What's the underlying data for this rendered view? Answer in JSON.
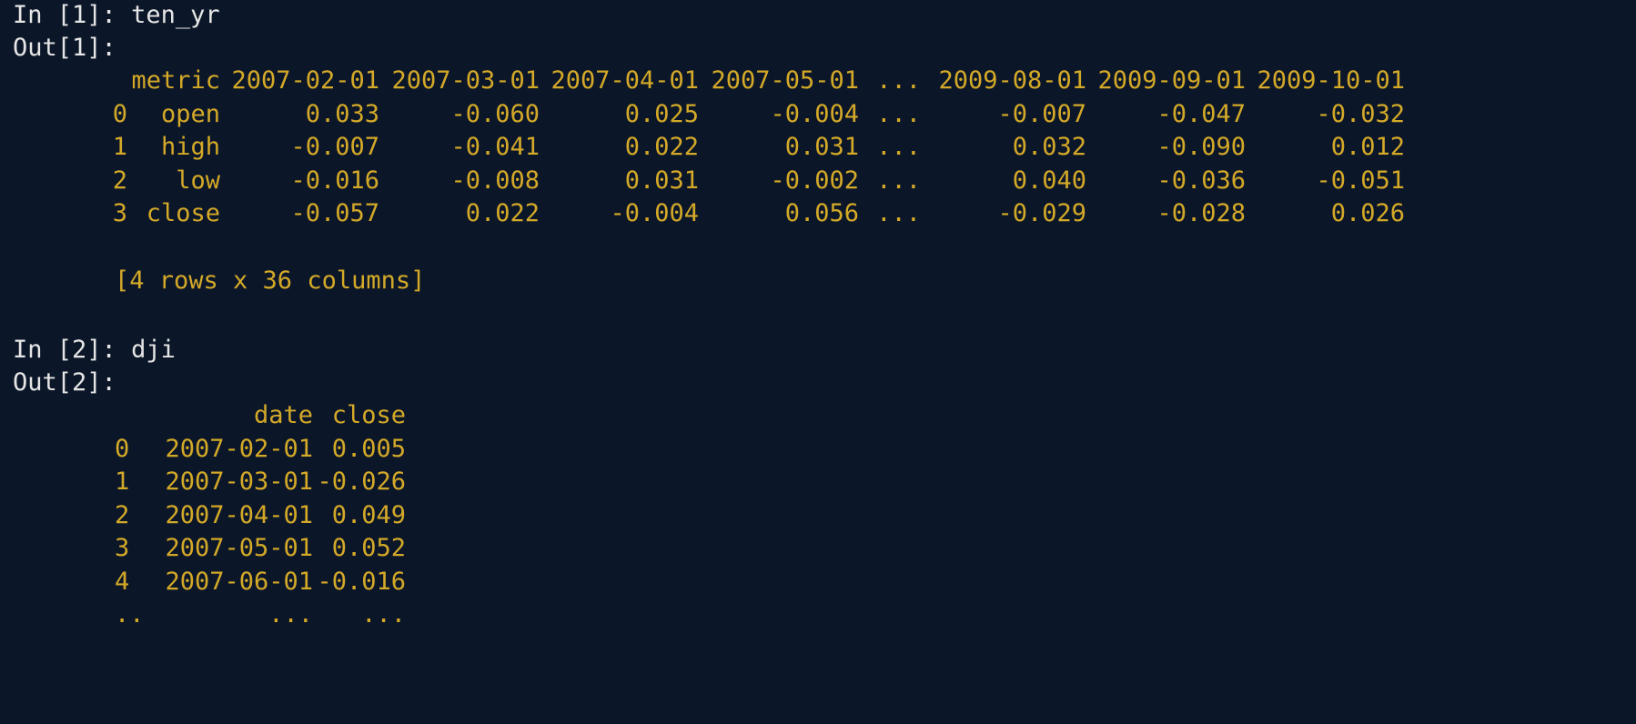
{
  "cells": [
    {
      "in_prompt": "In [1]:",
      "in_code": "ten_yr",
      "out_prompt": "Out[1]:",
      "table": {
        "index_header": "",
        "columns": [
          "metric",
          "2007-02-01",
          "2007-03-01",
          "2007-04-01",
          "2007-05-01",
          "...",
          "2009-08-01",
          "2009-09-01",
          "2009-10-01"
        ],
        "rows": [
          {
            "index": "0",
            "values": [
              "open",
              "0.033",
              "-0.060",
              "0.025",
              "-0.004",
              "...",
              "-0.007",
              "-0.047",
              "-0.032"
            ]
          },
          {
            "index": "1",
            "values": [
              "high",
              "-0.007",
              "-0.041",
              "0.022",
              "0.031",
              "...",
              "0.032",
              "-0.090",
              "0.012"
            ]
          },
          {
            "index": "2",
            "values": [
              "low",
              "-0.016",
              "-0.008",
              "0.031",
              "-0.002",
              "...",
              "0.040",
              "-0.036",
              "-0.051"
            ]
          },
          {
            "index": "3",
            "values": [
              "close",
              "-0.057",
              "0.022",
              "-0.004",
              "0.056",
              "...",
              "-0.029",
              "-0.028",
              "0.026"
            ]
          }
        ],
        "summary": "[4 rows x 36 columns]"
      }
    },
    {
      "in_prompt": "In [2]:",
      "in_code": "dji",
      "out_prompt": "Out[2]:",
      "table": {
        "columns": [
          "date",
          "close"
        ],
        "rows": [
          {
            "index": "0",
            "values": [
              "2007-02-01",
              "0.005"
            ]
          },
          {
            "index": "1",
            "values": [
              "2007-03-01",
              "-0.026"
            ]
          },
          {
            "index": "2",
            "values": [
              "2007-04-01",
              "0.049"
            ]
          },
          {
            "index": "3",
            "values": [
              "2007-05-01",
              "0.052"
            ]
          },
          {
            "index": "4",
            "values": [
              "2007-06-01",
              "-0.016"
            ]
          },
          {
            "index": "..",
            "values": [
              "...",
              "..."
            ]
          }
        ]
      }
    }
  ],
  "colors": {
    "background": "#0b1628",
    "prompt": "#e6e6e6",
    "output": "#d4a928"
  }
}
